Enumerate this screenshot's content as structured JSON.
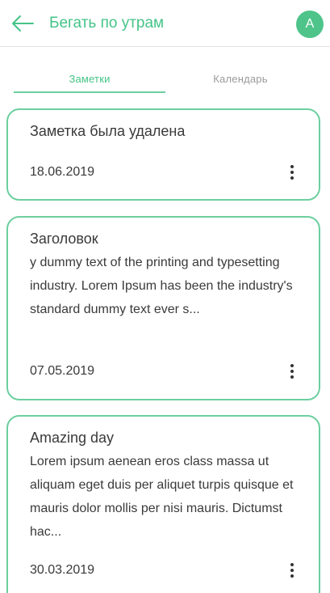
{
  "header": {
    "title": "Бегать по утрам",
    "avatar_letter": "A",
    "accent_color": "#45c488"
  },
  "tabs": [
    {
      "label": "Заметки",
      "active": true
    },
    {
      "label": "Календарь",
      "active": false
    }
  ],
  "notes": [
    {
      "title": "Заметка была удалена",
      "body": "",
      "date": "18.06.2019"
    },
    {
      "title": "Заголовок",
      "body": "y dummy text of the printing and typesetting industry. Lorem Ipsum has been the industry's standard dummy text ever s...",
      "date": "07.05.2019"
    },
    {
      "title": "Amazing day",
      "body": "Lorem ipsum aenean eros class massa ut aliquam eget duis per aliquet turpis quisque et mauris dolor mollis per nisi mauris. Dictumst hac...",
      "date": "30.03.2019"
    }
  ],
  "icons": {
    "back": "arrow-left-icon",
    "more": "more-vertical-icon"
  }
}
